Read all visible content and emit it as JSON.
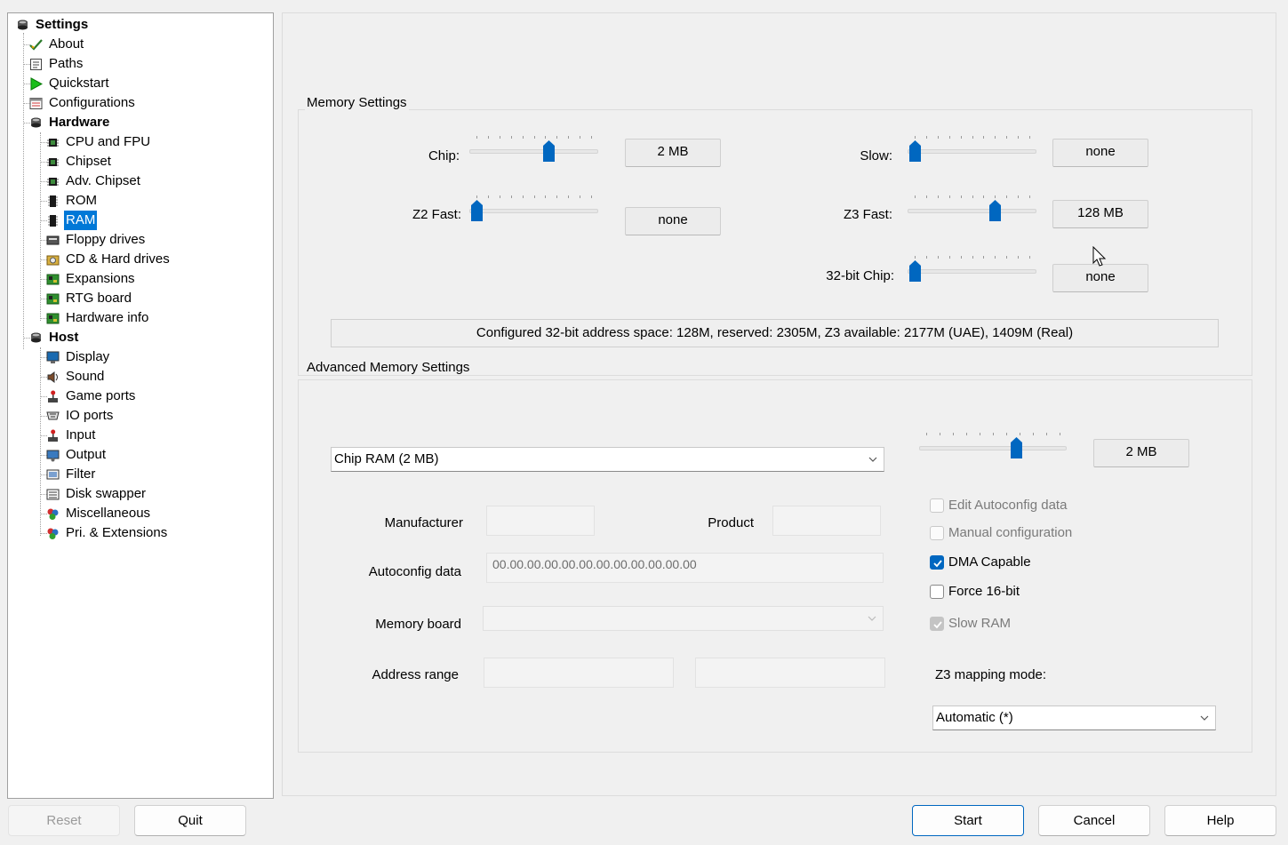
{
  "tree": {
    "items": [
      {
        "label": "Settings",
        "icon": "settings-icon",
        "level": 0,
        "bold": true
      },
      {
        "label": "About",
        "icon": "about-check-icon",
        "level": 1
      },
      {
        "label": "Paths",
        "icon": "paths-icon",
        "level": 1
      },
      {
        "label": "Quickstart",
        "icon": "quickstart-play-icon",
        "level": 1
      },
      {
        "label": "Configurations",
        "icon": "configurations-icon",
        "level": 1
      },
      {
        "label": "Hardware",
        "icon": "hardware-icon",
        "level": 1,
        "bold": true
      },
      {
        "label": "CPU and FPU",
        "icon": "chip-icon",
        "level": 2
      },
      {
        "label": "Chipset",
        "icon": "chip-icon",
        "level": 2
      },
      {
        "label": "Adv. Chipset",
        "icon": "chip-icon",
        "level": 2
      },
      {
        "label": "ROM",
        "icon": "rom-icon",
        "level": 2
      },
      {
        "label": "RAM",
        "icon": "ram-icon",
        "level": 2,
        "selected": true
      },
      {
        "label": "Floppy drives",
        "icon": "floppy-icon",
        "level": 2
      },
      {
        "label": "CD & Hard drives",
        "icon": "drive-icon",
        "level": 2
      },
      {
        "label": "Expansions",
        "icon": "board-icon",
        "level": 2
      },
      {
        "label": "RTG board",
        "icon": "board-icon",
        "level": 2
      },
      {
        "label": "Hardware info",
        "icon": "board-icon",
        "level": 2
      },
      {
        "label": "Host",
        "icon": "host-icon",
        "level": 1,
        "bold": true
      },
      {
        "label": "Display",
        "icon": "display-icon",
        "level": 2
      },
      {
        "label": "Sound",
        "icon": "sound-icon",
        "level": 2
      },
      {
        "label": "Game ports",
        "icon": "joystick-icon",
        "level": 2
      },
      {
        "label": "IO ports",
        "icon": "io-ports-icon",
        "level": 2
      },
      {
        "label": "Input",
        "icon": "joystick-icon",
        "level": 2
      },
      {
        "label": "Output",
        "icon": "output-icon",
        "level": 2
      },
      {
        "label": "Filter",
        "icon": "filter-icon",
        "level": 2
      },
      {
        "label": "Disk swapper",
        "icon": "disk-swapper-icon",
        "level": 2
      },
      {
        "label": "Miscellaneous",
        "icon": "misc-icon",
        "level": 2
      },
      {
        "label": "Pri. & Extensions",
        "icon": "misc-icon",
        "level": 2
      }
    ]
  },
  "memory_settings": {
    "title": "Memory Settings",
    "chip": {
      "label": "Chip:",
      "value": "2 MB",
      "level": 0.625
    },
    "z2fast": {
      "label": "Z2 Fast:",
      "value": "none",
      "level": 0.0
    },
    "slow": {
      "label": "Slow:",
      "value": "none",
      "level": 0.0
    },
    "z3fast": {
      "label": "Z3 Fast:",
      "value": "128 MB",
      "level": 0.7
    },
    "chip32": {
      "label": "32-bit Chip:",
      "value": "none",
      "level": 0.0
    },
    "info": "Configured 32-bit address space: 128M, reserved: 2305M, Z3 available: 2177M (UAE), 1409M (Real)"
  },
  "advanced": {
    "title": "Advanced Memory Settings",
    "board_select": "Chip RAM (2 MB)",
    "slider_value": "2 MB",
    "slider_level": 0.67,
    "manufacturer_label": "Manufacturer",
    "product_label": "Product",
    "autoconfig_label": "Autoconfig data",
    "autoconfig_value": "00.00.00.00.00.00.00.00.00.00.00.00",
    "memory_board_label": "Memory board",
    "address_range_label": "Address range",
    "edit_autoconfig": {
      "label": "Edit Autoconfig data",
      "checked": false,
      "enabled": false
    },
    "manual_config": {
      "label": "Manual configuration",
      "checked": false,
      "enabled": false
    },
    "dma_capable": {
      "label": "DMA Capable",
      "checked": true,
      "enabled": true
    },
    "force16": {
      "label": "Force 16-bit",
      "checked": false,
      "enabled": true
    },
    "slow_ram": {
      "label": "Slow RAM",
      "checked": true,
      "enabled": false
    },
    "z3_mapping_label": "Z3 mapping mode:",
    "z3_mapping_value": "Automatic (*)"
  },
  "buttons": {
    "reset": "Reset",
    "quit": "Quit",
    "start": "Start",
    "cancel": "Cancel",
    "help": "Help"
  },
  "colors": {
    "accent": "#0078d7",
    "checkbox": "#0067c0"
  }
}
